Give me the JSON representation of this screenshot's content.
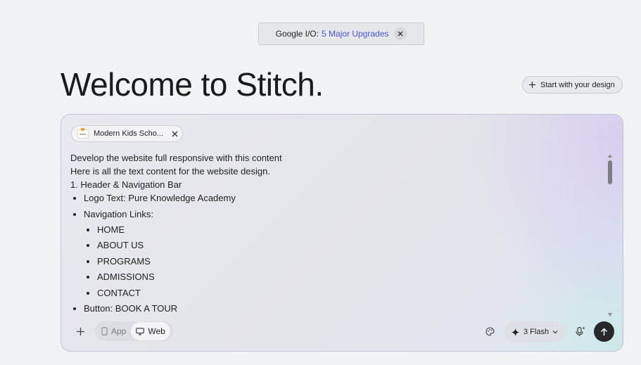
{
  "announcement": {
    "prefix": "Google I/O:",
    "link": "5 Major Upgrades",
    "close_icon": "close-icon"
  },
  "page_title": "Welcome to Stitch.",
  "start_button": {
    "label": "Start with your design",
    "icon": "plus-icon"
  },
  "attachment_chip": {
    "label": "Modern Kids Scho...",
    "icon": "thumbnail-image",
    "close_icon": "close-icon"
  },
  "prompt": {
    "lines": [
      "Develop the website full responsive with this content",
      "Here is all the text content for the website design.",
      "1. Header & Navigation Bar"
    ],
    "bullets": {
      "logo_text": "Logo Text: Pure Knowledge Academy",
      "nav_links_title": "Navigation Links:",
      "nav_links": [
        "HOME",
        "ABOUT US",
        "PROGRAMS",
        "ADMISSIONS",
        "CONTACT"
      ],
      "button_text": "Button: BOOK A TOUR"
    }
  },
  "toolbar": {
    "add_icon": "plus-icon",
    "platform": {
      "options": [
        {
          "label": "App",
          "icon": "phone-icon"
        },
        {
          "label": "Web",
          "icon": "monitor-icon"
        }
      ],
      "selected": "Web"
    },
    "palette_icon": "palette-icon",
    "model": {
      "label": "3 Flash",
      "icon": "sparkle-icon",
      "chevron": "chevron-down-icon"
    },
    "mic_icon": "mic-sparkle-icon",
    "send_icon": "arrow-up-icon"
  },
  "colors": {
    "background": "#f1f2f4",
    "link": "#4a56d6",
    "send_button": "#26282c"
  }
}
